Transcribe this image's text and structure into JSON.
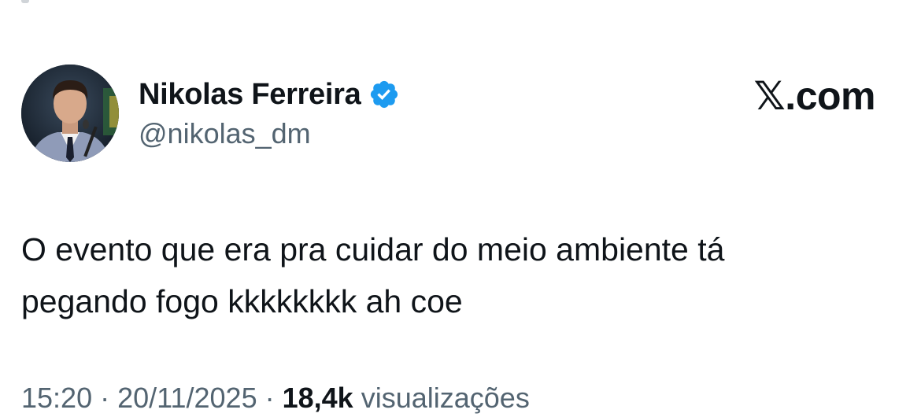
{
  "author": {
    "display_name": "Nikolas Ferreira",
    "handle": "@nikolas_dm",
    "verified": true,
    "verified_color": "#1d9bf0"
  },
  "brand": {
    "glyph": "𝕏",
    "suffix": ".com"
  },
  "post": {
    "text": "O evento que era pra cuidar do meio ambiente tá\npegando fogo kkkkkkkk ah coe"
  },
  "meta": {
    "time": "15:20",
    "separator": " · ",
    "date": "20/11/2025",
    "views_count": "18,4k",
    "views_label": "visualizações"
  },
  "colors": {
    "text_primary": "#0f1419",
    "text_secondary": "#536471",
    "background": "#ffffff"
  },
  "icons": {
    "avatar": "profile-photo",
    "verified": "verified-badge-icon",
    "brand": "x-logo-icon"
  }
}
